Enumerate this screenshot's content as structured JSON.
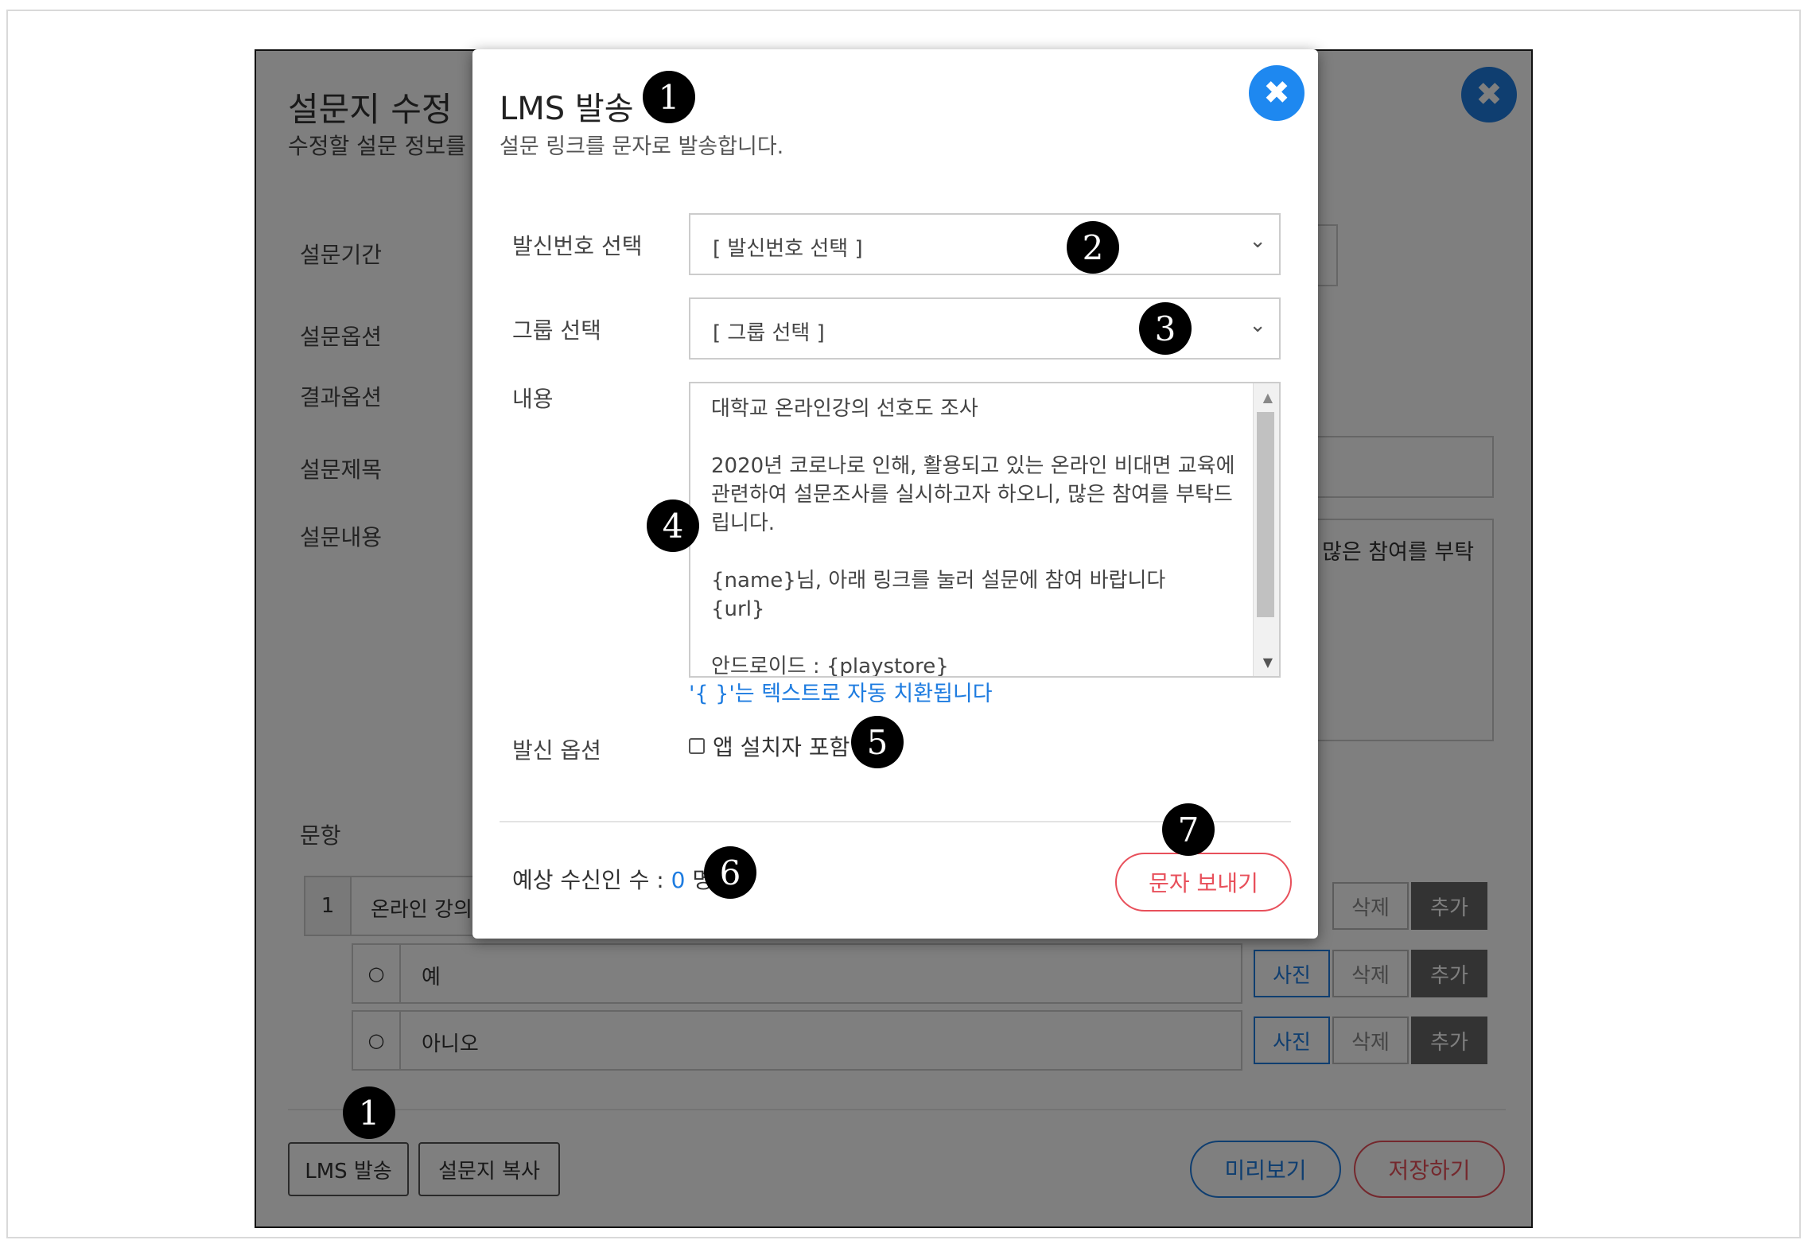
{
  "background": {
    "title": "설문지 수정",
    "subtitle": "수정할 설문 정보를",
    "labels": {
      "period": "설문기간",
      "options": "설문옵션",
      "result_options": "결과옵션",
      "survey_title": "설문제목",
      "survey_content": "설문내용",
      "questions": "문항"
    },
    "content_partial": "많은 참여를 부탁",
    "question": {
      "number": "1",
      "text": "온라인 강의"
    },
    "answer_options": [
      {
        "text": "예",
        "radio": "○"
      },
      {
        "text": "아니오",
        "radio": "○"
      }
    ],
    "row_buttons": {
      "photo": "사진",
      "delete": "삭제",
      "add": "추가"
    },
    "footer": {
      "lms_send": "LMS 발송",
      "copy": "설문지 복사",
      "preview": "미리보기",
      "save": "저장하기"
    },
    "close_symbol": "✖"
  },
  "modal": {
    "title": "LMS 발송",
    "subtitle": "설문 링크를 문자로 발송합니다.",
    "close_symbol": "✖",
    "sender_label": "발신번호 선택",
    "sender_value": "[ 발신번호 선택 ]",
    "group_label": "그룹 선택",
    "group_value": "[ 그룹 선택 ]",
    "content_label": "내용",
    "content_text": "대학교 온라인강의 선호도 조사\n\n2020년 코로나로 인해, 활용되고 있는 온라인 비대면 교육에 관련하여 설문조사를 실시하고자 하오니, 많은 참여를 부탁드립니다.\n\n{name}님, 아래 링크를 눌러 설문에 참여 바랍니다\n{url}\n\n안드로이드 : {playstore}",
    "hint": "'{ }'는 텍스트로 자동 치환됩니다",
    "send_option_label": "발신 옵션",
    "include_app_users": "앱 설치자 포함",
    "recipients_label": "예상 수신인 수 :",
    "recipients_count": "0",
    "recipients_unit": "명",
    "send_button": "문자 보내기"
  },
  "annotations": [
    "1",
    "2",
    "3",
    "4",
    "5",
    "6",
    "7",
    "1"
  ],
  "colors": {
    "accent": "#1e7ce0",
    "danger": "#e8505b",
    "overlay": "#000000"
  }
}
